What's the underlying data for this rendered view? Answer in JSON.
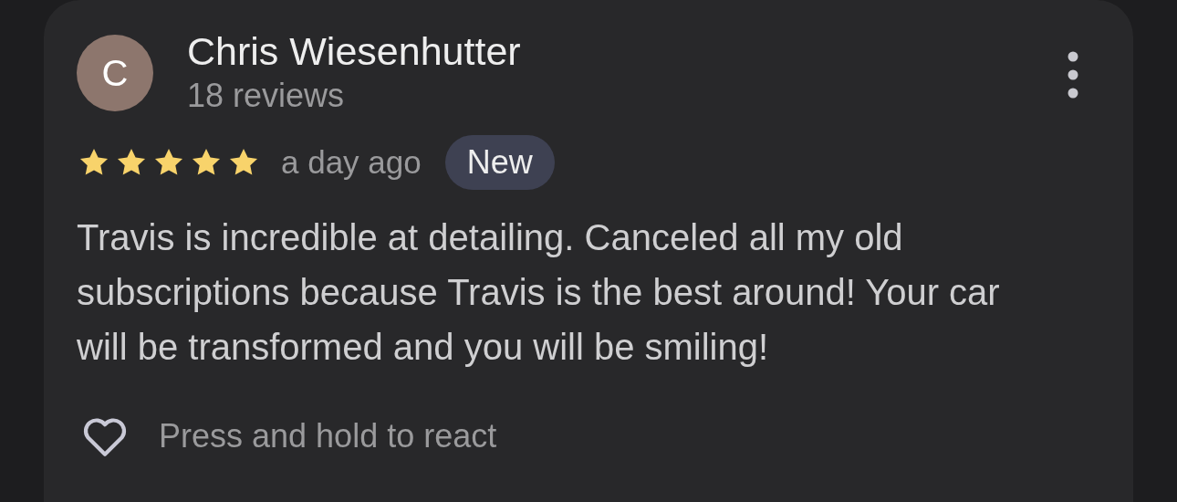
{
  "review": {
    "avatar_letter": "C",
    "author": "Chris Wiesenhutter",
    "review_count": "18 reviews",
    "stars": 5,
    "time": "a day ago",
    "badge": "New",
    "text": "Travis is incredible at detailing. Canceled all my old subscriptions because Travis is the best around! Your car will be transformed and you will be smiling!",
    "react_hint": "Press and hold to react"
  }
}
